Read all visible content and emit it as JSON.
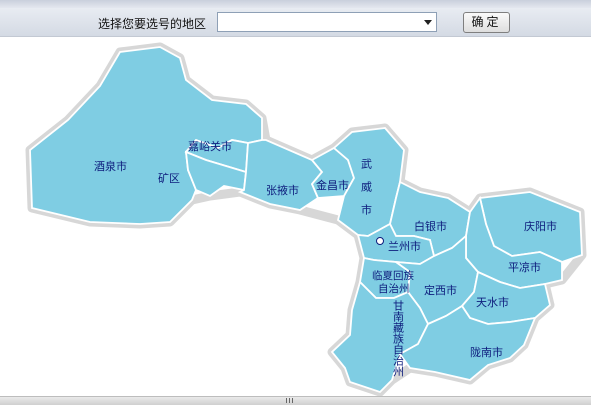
{
  "toolbar": {
    "prompt": "选择您要选号的地区",
    "select_value": "",
    "ok_label": "确定"
  },
  "map": {
    "capital_marker": "lanzhou-capital-dot",
    "regions": {
      "jiuquan": "酒泉市",
      "jiayuguan": "嘉峪关市",
      "kuangqu": "矿区",
      "zhangye": "张掖市",
      "jinchang": "金昌市",
      "wuwei": "武威市",
      "baiyin": "白银市",
      "lanzhou": "兰州市",
      "qingyang": "庆阳市",
      "pingliang": "平凉市",
      "linxia": "临夏回族自治州",
      "dingxi": "定西市",
      "tianshui": "天水市",
      "gannan": "甘南藏族自治州",
      "longnan": "陇南市"
    }
  },
  "colors": {
    "region_fill": "#7fcde3",
    "label_text": "#0d1c7c"
  }
}
